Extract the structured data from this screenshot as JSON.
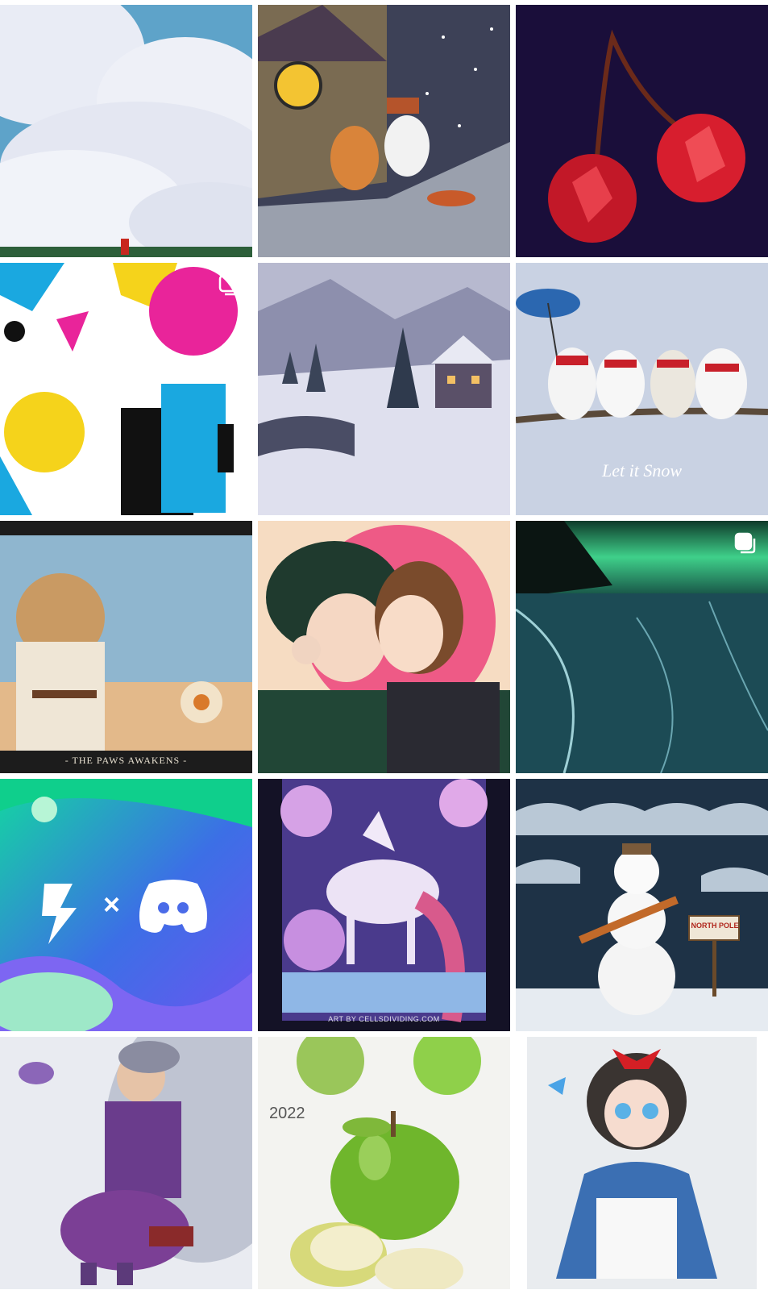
{
  "feed": {
    "tiles": [
      {
        "id": "t1",
        "subject": "sky-clouds"
      },
      {
        "id": "t2",
        "subject": "winter-cabin-kids"
      },
      {
        "id": "t3",
        "subject": "crystal-cherries"
      },
      {
        "id": "t4",
        "subject": "cmyk-comic"
      },
      {
        "id": "t5",
        "subject": "snowy-village"
      },
      {
        "id": "t6",
        "subject": "snow-animals"
      },
      {
        "id": "t7",
        "subject": "cat-jedi"
      },
      {
        "id": "t8",
        "subject": "anime-couple"
      },
      {
        "id": "t9",
        "subject": "aurora-lake"
      },
      {
        "id": "t10",
        "subject": "deviantart-discord"
      },
      {
        "id": "t11",
        "subject": "unicorn"
      },
      {
        "id": "t12",
        "subject": "snowman"
      },
      {
        "id": "t13",
        "subject": "elf-grandma-tea"
      },
      {
        "id": "t14",
        "subject": "green-apple"
      },
      {
        "id": "t15",
        "subject": "snow-white-doll"
      }
    ],
    "texts": {
      "let_it_snow": "Let it Snow",
      "paws_awakens": "- THE PAWS AWAKENS -",
      "art_by": "ART BY CELLSDIVIDING.COM",
      "north_pole": "NORTH POLE",
      "year": "2022"
    },
    "icons": {
      "multi": "multiple-photos-icon"
    }
  }
}
